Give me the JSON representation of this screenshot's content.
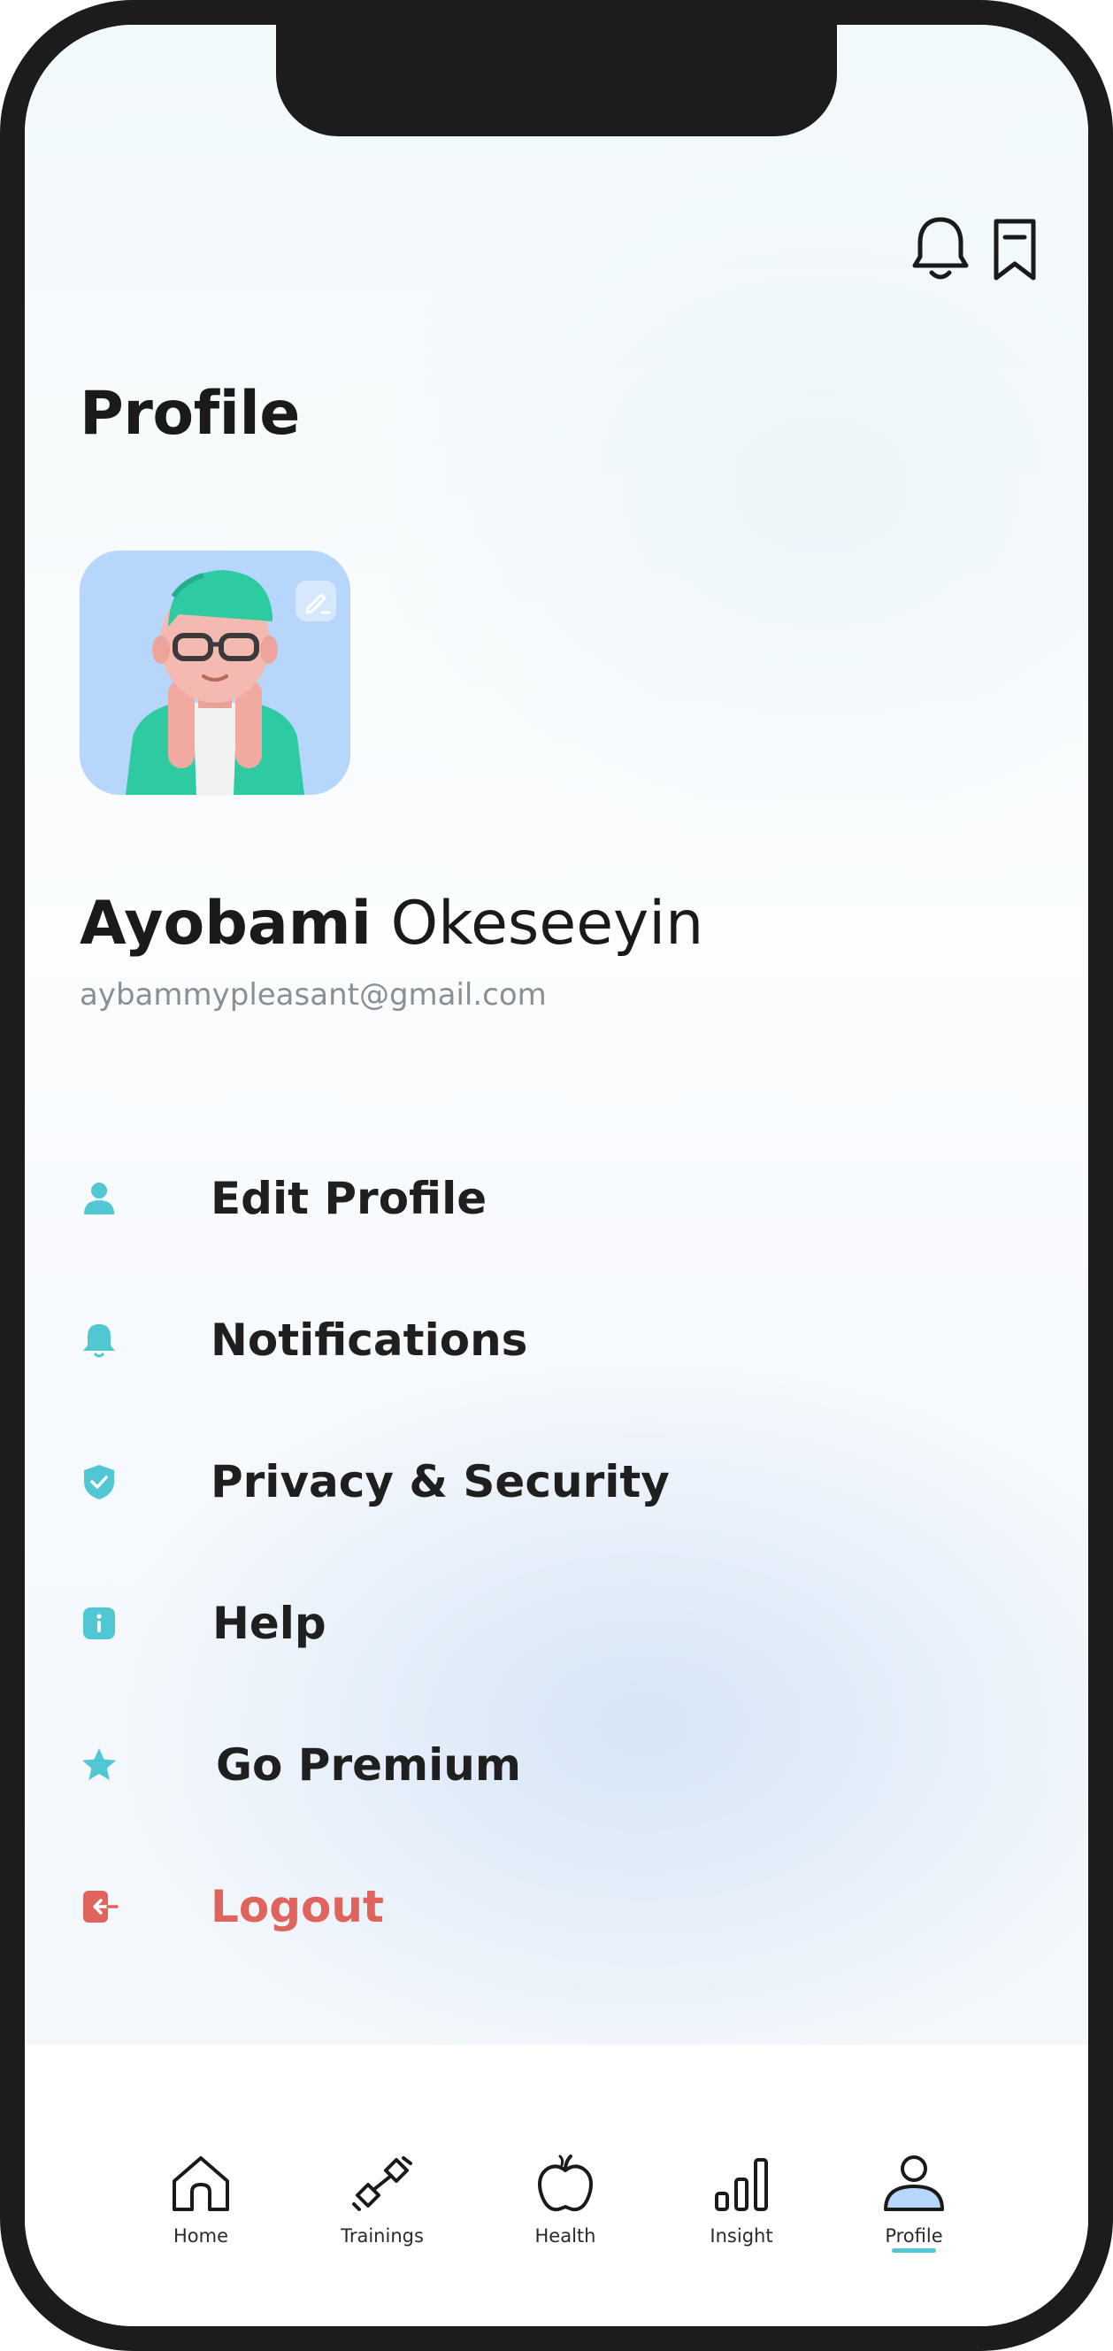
{
  "header": {
    "title": "Profile",
    "icons": [
      "bell-icon",
      "bookmark-icon"
    ]
  },
  "user": {
    "first_name": "Ayobami",
    "last_name": "Okeseeyin",
    "email": "aybammypleasant@gmail.com"
  },
  "menu": [
    {
      "label": "Edit Profile",
      "icon": "person-icon"
    },
    {
      "label": "Notifications",
      "icon": "bell-icon"
    },
    {
      "label": "Privacy & Security",
      "icon": "shield-icon"
    },
    {
      "label": "Help",
      "icon": "info-icon"
    },
    {
      "label": "Go Premium",
      "icon": "star-icon"
    },
    {
      "label": "Logout",
      "icon": "logout-icon"
    }
  ],
  "tabs": [
    {
      "label": "Home",
      "icon": "home-icon"
    },
    {
      "label": "Trainings",
      "icon": "dumbbell-icon"
    },
    {
      "label": "Health",
      "icon": "apple-icon"
    },
    {
      "label": "Insight",
      "icon": "bar-chart-icon"
    },
    {
      "label": "Profile",
      "icon": "person-icon",
      "active": true
    }
  ],
  "colors": {
    "accent": "#52c7d4",
    "logout": "#e0645b",
    "text": "#1a1a1a",
    "muted": "#8a8f94"
  }
}
